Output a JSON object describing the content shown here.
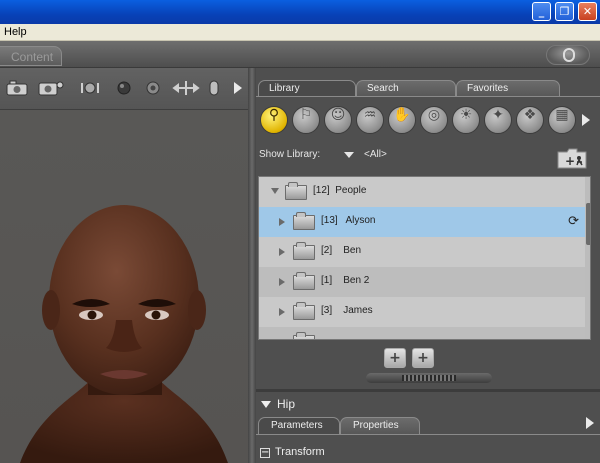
{
  "window": {
    "controls": {
      "minimize": "_",
      "restore": "❐",
      "close": "✕"
    }
  },
  "menu": {
    "items": [
      "Help"
    ]
  },
  "room_tabs": {
    "content": "Content"
  },
  "library": {
    "tabs": [
      "Library",
      "Search",
      "Favorites"
    ],
    "categories": [
      {
        "name": "figures-icon",
        "glyph": "⚲",
        "active": true
      },
      {
        "name": "poses-icon",
        "glyph": "⚐",
        "active": false
      },
      {
        "name": "expressions-icon",
        "glyph": "☺",
        "active": false
      },
      {
        "name": "hair-icon",
        "glyph": "♒",
        "active": false
      },
      {
        "name": "hands-icon",
        "glyph": "✋",
        "active": false
      },
      {
        "name": "props-icon",
        "glyph": "◎",
        "active": false
      },
      {
        "name": "lights-icon",
        "glyph": "☀",
        "active": false
      },
      {
        "name": "cameras-icon",
        "glyph": "✦",
        "active": false
      },
      {
        "name": "materials-icon",
        "glyph": "❖",
        "active": false
      },
      {
        "name": "scenes-icon",
        "glyph": "▦",
        "active": false
      }
    ],
    "show_library_label": "Show Library:",
    "show_library_value": "<All>",
    "tree": [
      {
        "text": "[12]  People",
        "level": 0,
        "expanded": true,
        "selected": false
      },
      {
        "text": "[13]   Alyson",
        "level": 1,
        "expanded": false,
        "selected": true
      },
      {
        "text": "[2]    Ben",
        "level": 1,
        "expanded": false,
        "selected": false
      },
      {
        "text": "[1]    Ben 2",
        "level": 1,
        "expanded": false,
        "selected": false
      },
      {
        "text": "[3]    James",
        "level": 1,
        "expanded": false,
        "selected": false
      }
    ],
    "buttons": {
      "add_to_library": "+",
      "add": "+"
    }
  },
  "parameters": {
    "actor": "Hip",
    "tabs": [
      "Parameters",
      "Properties"
    ],
    "group": "Transform",
    "group_toggle": "−"
  }
}
